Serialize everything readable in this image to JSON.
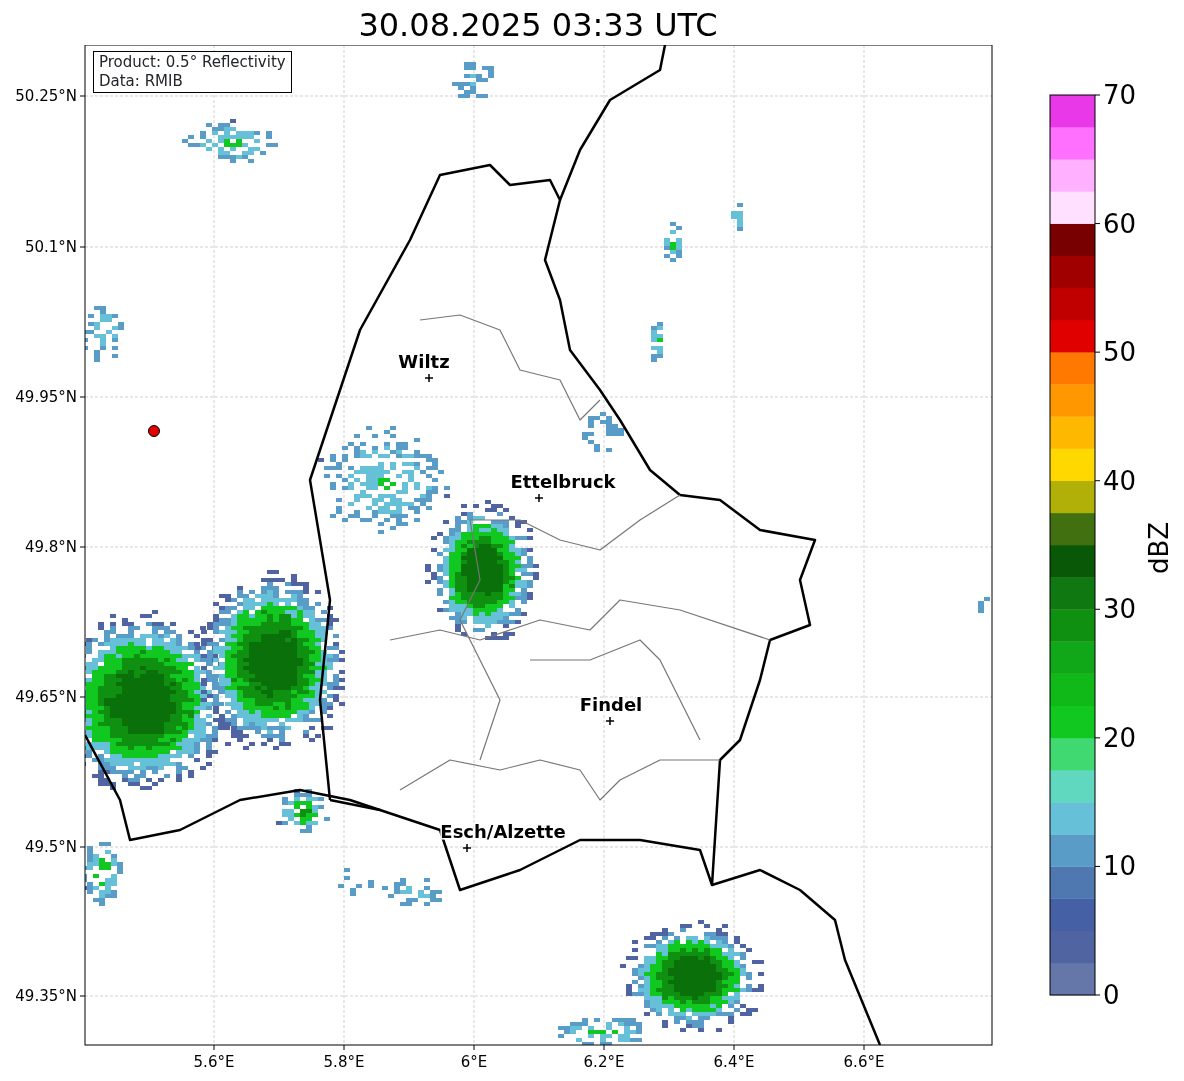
{
  "title": "30.08.2025 03:33 UTC",
  "info_box": {
    "lines": [
      "Product: 0.5° Reflectivity",
      "Data: RMIB"
    ]
  },
  "y_ticks": [
    "50.25°N",
    "50.1°N",
    "49.95°N",
    "49.8°N",
    "49.65°N",
    "49.5°N",
    "49.35°N"
  ],
  "x_ticks": [
    "5.6°E",
    "5.8°E",
    "6°E",
    "6.2°E",
    "6.4°E",
    "6.6°E"
  ],
  "cities": [
    {
      "name": "Wiltz"
    },
    {
      "name": "Ettelbruck"
    },
    {
      "name": "Findel"
    },
    {
      "name": "Esch/Alzette"
    }
  ],
  "colorbar": {
    "label": "dBZ",
    "ticks": [
      "70",
      "60",
      "50",
      "40",
      "30",
      "20",
      "10",
      "0"
    ],
    "bands": [
      {
        "color": "#6577a8"
      },
      {
        "color": "#4f64a0"
      },
      {
        "color": "#4560a4"
      },
      {
        "color": "#4f78b0"
      },
      {
        "color": "#5a9cc8"
      },
      {
        "color": "#65c0d8"
      },
      {
        "color": "#60d8c0"
      },
      {
        "color": "#40d870"
      },
      {
        "color": "#10c820"
      },
      {
        "color": "#10b818"
      },
      {
        "color": "#10a818"
      },
      {
        "color": "#109010"
      },
      {
        "color": "#107810"
      },
      {
        "color": "#085808"
      },
      {
        "color": "#407010"
      },
      {
        "color": "#b0b008"
      },
      {
        "color": "#ffd800"
      },
      {
        "color": "#ffb800"
      },
      {
        "color": "#ff9800"
      },
      {
        "color": "#ff7800"
      },
      {
        "color": "#e00000"
      },
      {
        "color": "#c00000"
      },
      {
        "color": "#a00000"
      },
      {
        "color": "#780000"
      },
      {
        "color": "#ffe0ff"
      },
      {
        "color": "#ffb0ff"
      },
      {
        "color": "#ff70ff"
      },
      {
        "color": "#e838e8"
      }
    ]
  }
}
